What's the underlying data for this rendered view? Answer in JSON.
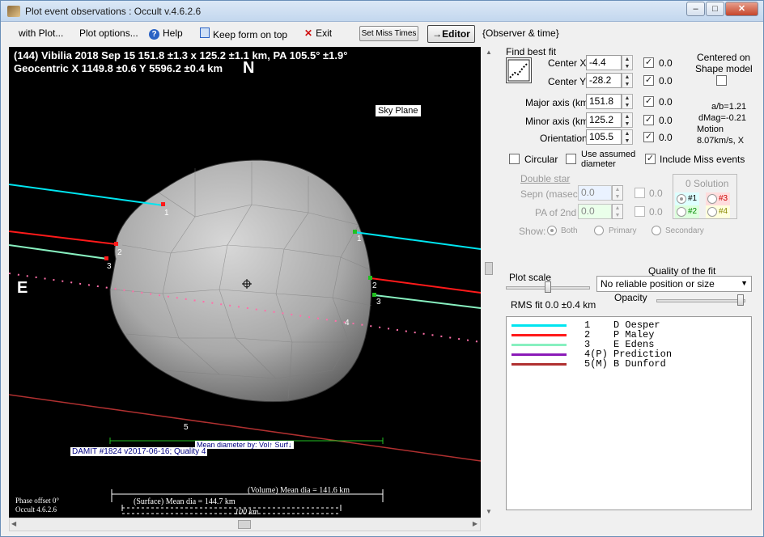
{
  "window": {
    "title": "Plot event observations : Occult v.4.6.2.6"
  },
  "menu": {
    "with_plot": "with Plot...",
    "plot_options": "Plot options...",
    "help": "Help",
    "keep_on_top": "Keep form on top",
    "exit": "Exit",
    "set_miss_times": "Set Miss Times",
    "editor": "→Editor",
    "observer_time": "{Observer & time}"
  },
  "plot": {
    "header_line1": "(144) Vibilia  2018 Sep 15   151.8 ±1.3 x 125.2 ±1.1 km, PA 105.5° ±1.9°",
    "header_line2": "Geocentric  X  1149.8 ±0.6   Y 5596.2 ±0.4 km",
    "north": "N",
    "east": "E",
    "sky_plane": "Sky Plane",
    "damit": "DAMIT #1824 v2017-06-16; Quality 4",
    "mean_dia_by": "Mean diameter by: Vol↑ Surf↓",
    "volume_dia": "(Volume) Mean dia = 141.6 km",
    "surface_dia": "(Surface) Mean dia = 144.7 km",
    "scale_bar": "100 km",
    "phase_offset": "Phase offset 0°",
    "version": "Occult 4.6.2.6",
    "chord_labels": [
      "1",
      "2",
      "3",
      "1",
      "2",
      "3",
      "4",
      "5"
    ]
  },
  "fit": {
    "find_best_fit": "Find best fit",
    "center_x_label": "Center X",
    "center_x": "-4.4",
    "center_x_sd": "0.0",
    "center_y_label": "Center Y",
    "center_y": "-28.2",
    "center_y_sd": "0.0",
    "centered_on": "Centered on",
    "shape_model": "Shape model",
    "major_label": "Major axis (km)",
    "major": "151.8",
    "major_sd": "0.0",
    "minor_label": "Minor axis (km)",
    "minor": "125.2",
    "minor_sd": "0.0",
    "orient_label": "Orientation",
    "orient": "105.5",
    "orient_sd": "0.0",
    "ab_ratio": "a/b=1.21",
    "dmag": "dMag=-0.21",
    "motion_label": "Motion",
    "motion": "8.07km/s, X",
    "circular": "Circular",
    "assumed_dia": "Use assumed diameter",
    "include_miss": "Include Miss events",
    "double_star": "Double star",
    "sepn_label": "Sepn (masec)",
    "sepn": "0.0",
    "sepn_sd": "0.0",
    "pa2_label": "PA of 2nd",
    "pa2": "0.0",
    "pa2_sd": "0.0",
    "show_label": "Show:",
    "show_both": "Both",
    "show_primary": "Primary",
    "show_secondary": "Secondary",
    "solution_title": "0 Solution",
    "sol1": "#1",
    "sol2": "#2",
    "sol3": "#3",
    "sol4": "#4",
    "plot_scale": "Plot scale",
    "quality_label": "Quality of the fit",
    "quality_value": "No reliable position or size",
    "opacity": "Opacity",
    "rms": "RMS fit  0.0 ±0.4 km"
  },
  "colors": {
    "chord1": "#00e5f0",
    "chord2": "#ff1a1a",
    "chord3": "#88f0c0",
    "prediction": "#8a1ab8",
    "chord5": "#b03030",
    "path_dots": "#ff6fa8"
  },
  "legend": [
    {
      "num": "1",
      "tag": "   ",
      "name": "D Oesper",
      "color": "#00e5f0"
    },
    {
      "num": "2",
      "tag": "   ",
      "name": "P Maley",
      "color": "#ff1a1a"
    },
    {
      "num": "3",
      "tag": "   ",
      "name": "E Edens",
      "color": "#88f0c0"
    },
    {
      "num": "4",
      "tag": "(P)",
      "name": "Prediction",
      "color": "#8a1ab8"
    },
    {
      "num": "5",
      "tag": "(M)",
      "name": "B Dunford",
      "color": "#b03030"
    }
  ]
}
